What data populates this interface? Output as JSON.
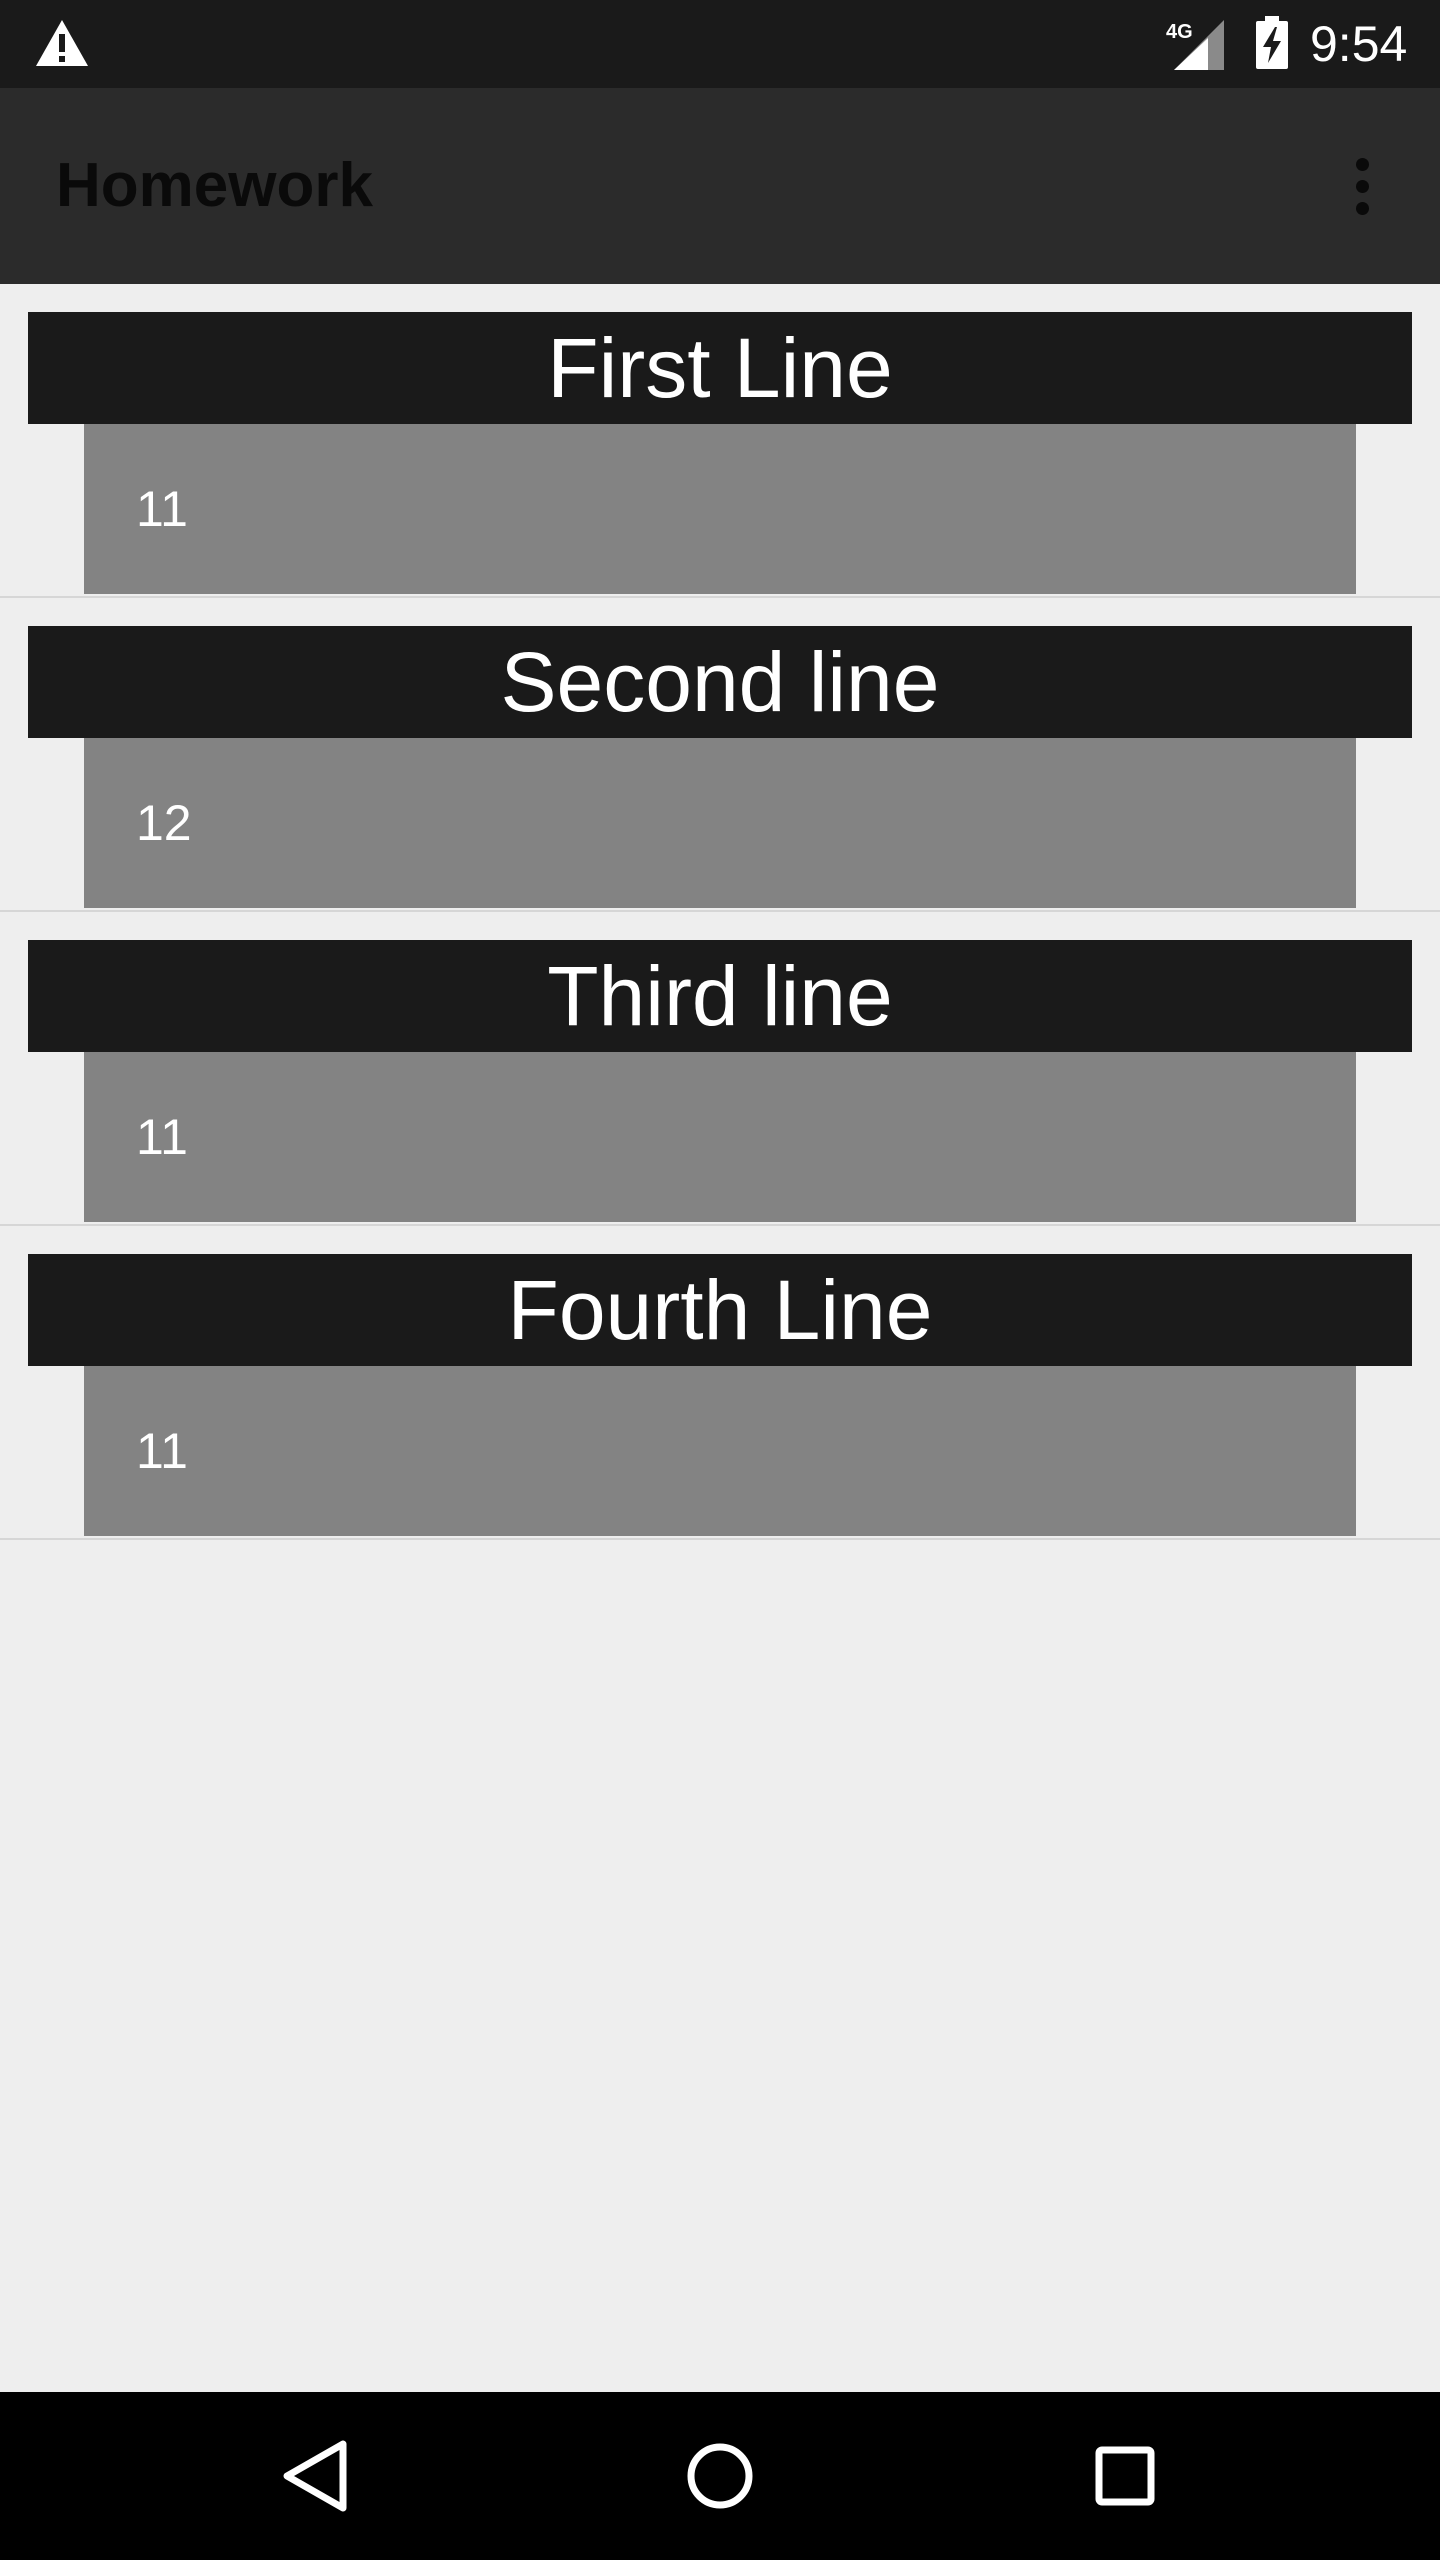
{
  "status_bar": {
    "time": "9:54",
    "network_label": "4G",
    "icons": [
      "warning-icon",
      "cell-signal-icon",
      "battery-charging-icon"
    ]
  },
  "app_bar": {
    "title": "Homework",
    "menu_icon": "more-vertical-icon"
  },
  "list": {
    "items": [
      {
        "title": "First Line",
        "value": "11"
      },
      {
        "title": "Second line",
        "value": "12"
      },
      {
        "title": "Third line",
        "value": "11"
      },
      {
        "title": "Fourth Line",
        "value": "11"
      }
    ]
  },
  "nav_bar": {
    "icons": [
      "back-icon",
      "home-icon",
      "recents-icon"
    ]
  },
  "colors": {
    "status_bar": "#1a1a1a",
    "app_bar": "#2b2b2b",
    "background": "#eeeeee",
    "item_header": "#1a1a1a",
    "item_body": "#838383",
    "nav_bar": "#000000"
  }
}
